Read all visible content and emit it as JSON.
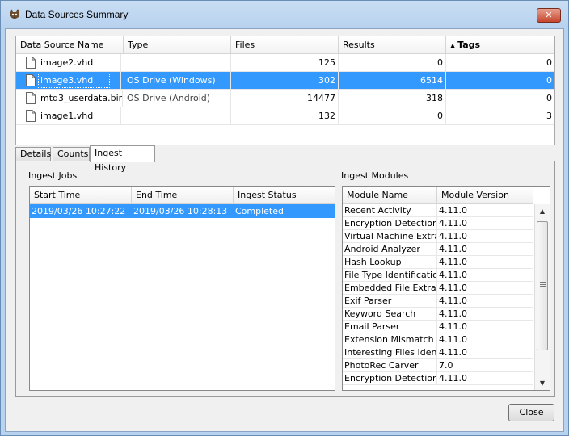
{
  "window": {
    "title": "Data Sources Summary",
    "close_glyph": "✕"
  },
  "datasources": {
    "columns": [
      "Data Source Name",
      "Type",
      "Files",
      "Results",
      "Tags"
    ],
    "sort_icon": "▲",
    "rows": [
      {
        "name": "image2.vhd",
        "type": "",
        "files": "125",
        "results": "0",
        "tags": "0"
      },
      {
        "name": "image3.vhd",
        "type": "OS Drive (Windows)",
        "files": "302",
        "results": "6514",
        "tags": "0"
      },
      {
        "name": "mtd3_userdata.bin",
        "type": "OS Drive (Android)",
        "files": "14477",
        "results": "318",
        "tags": "0"
      },
      {
        "name": "image1.vhd",
        "type": "",
        "files": "132",
        "results": "0",
        "tags": "3"
      }
    ]
  },
  "tabs": [
    "Details",
    "Counts",
    "Ingest History"
  ],
  "ingest_jobs": {
    "label": "Ingest Jobs",
    "columns": [
      "Start Time",
      "End Time",
      "Ingest Status"
    ],
    "rows": [
      {
        "start": "2019/03/26 10:27:22",
        "end": "2019/03/26 10:28:13",
        "status": "Completed"
      }
    ]
  },
  "ingest_modules": {
    "label": "Ingest Modules",
    "columns": [
      "Module Name",
      "Module Version"
    ],
    "rows": [
      {
        "name": "Recent Activity",
        "version": "4.11.0"
      },
      {
        "name": "Encryption Detection",
        "version": "4.11.0"
      },
      {
        "name": "Virtual Machine Extra...",
        "version": "4.11.0"
      },
      {
        "name": "Android Analyzer",
        "version": "4.11.0"
      },
      {
        "name": "Hash Lookup",
        "version": "4.11.0"
      },
      {
        "name": "File Type Identification",
        "version": "4.11.0"
      },
      {
        "name": "Embedded File Extrac...",
        "version": "4.11.0"
      },
      {
        "name": "Exif Parser",
        "version": "4.11.0"
      },
      {
        "name": "Keyword Search",
        "version": "4.11.0"
      },
      {
        "name": "Email Parser",
        "version": "4.11.0"
      },
      {
        "name": "Extension Mismatch ...",
        "version": "4.11.0"
      },
      {
        "name": "Interesting Files Iden...",
        "version": "4.11.0"
      },
      {
        "name": "PhotoRec Carver",
        "version": "7.0"
      },
      {
        "name": "Encryption Detection",
        "version": "4.11.0"
      }
    ],
    "scroll_up": "▲",
    "scroll_down": "▼"
  },
  "buttons": {
    "close": "Close"
  },
  "colors": {
    "selection": "#3399ff",
    "titlebar": "#b9d3ef"
  },
  "icons": {
    "app": "autopsy-dog-icon",
    "file": "file-icon"
  }
}
